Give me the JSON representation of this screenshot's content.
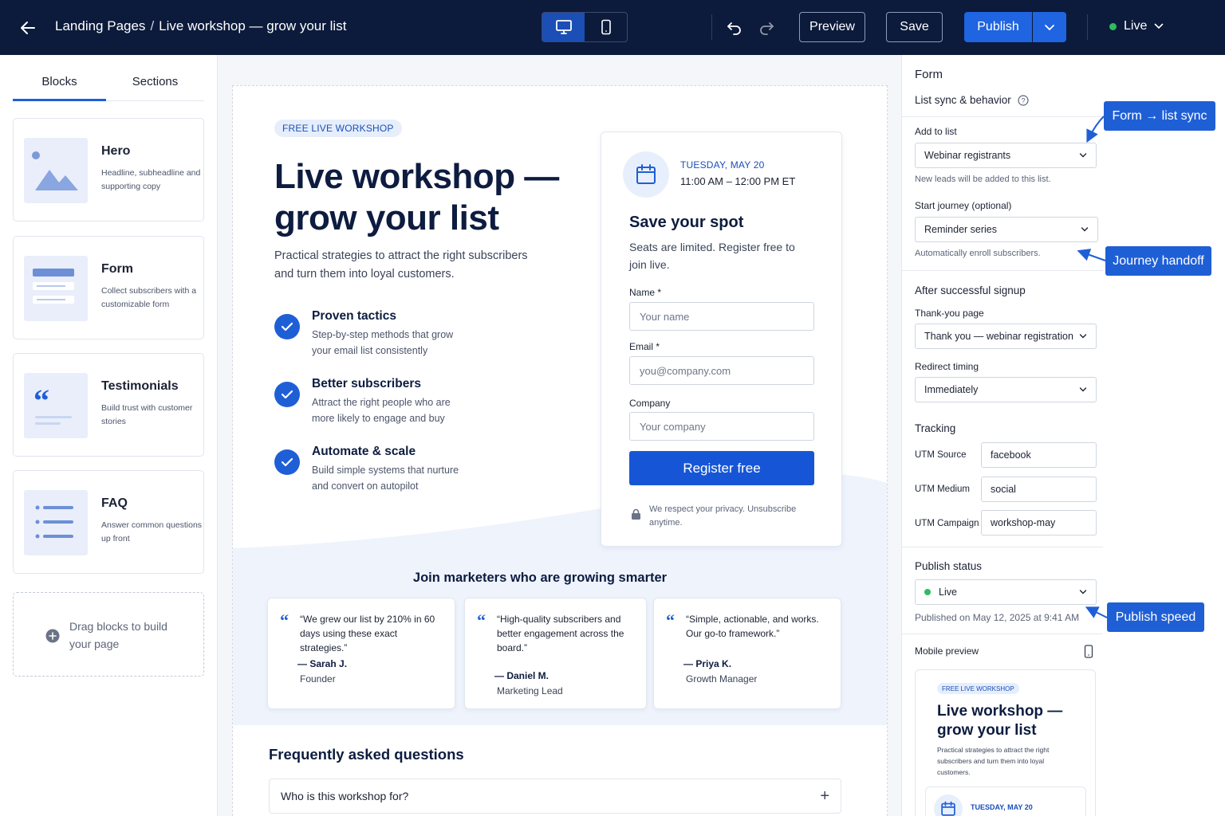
{
  "topbar": {
    "breadcrumb_root": "Landing Pages",
    "breadcrumb_sep": "/",
    "breadcrumb_page": "Live workshop — grow your list",
    "preview_label": "Preview",
    "save_label": "Save",
    "publish_label": "Publish",
    "status_label": "Live"
  },
  "left": {
    "tabs": [
      "Blocks",
      "Sections"
    ],
    "blocks": [
      {
        "title": "Hero",
        "desc": "Headline, subheadline and supporting copy"
      },
      {
        "title": "Form",
        "desc": "Collect subscribers with a customizable form"
      },
      {
        "title": "Testimonials",
        "desc": "Build trust with customer stories"
      },
      {
        "title": "FAQ",
        "desc": "Answer common questions up front"
      }
    ],
    "drop_text": "Drag blocks to build your page"
  },
  "canvas": {
    "badge": "FREE LIVE WORKSHOP",
    "title": "Live workshop — grow your list",
    "subtitle": "Practical strategies to attract the right subscribers and turn them into loyal customers.",
    "features": [
      {
        "title": "Proven tactics",
        "desc": "Step-by-step methods that grow your email list consistently"
      },
      {
        "title": "Better subscribers",
        "desc": "Attract the right people who are more likely to engage and buy"
      },
      {
        "title": "Automate & scale",
        "desc": "Build simple systems that nurture and convert on autopilot"
      }
    ],
    "form": {
      "date": "TUESDAY, MAY 20",
      "time": "11:00 AM – 12:00 PM ET",
      "title": "Save your spot",
      "subtitle": "Seats are limited. Register free to join live.",
      "name_label": "Name *",
      "name_placeholder": "Your name",
      "email_label": "Email *",
      "email_placeholder": "you@company.com",
      "company_label": "Company",
      "company_placeholder": "Your company",
      "submit_label": "Register free",
      "privacy": "We respect your privacy. Unsubscribe anytime."
    },
    "social_heading": "Join marketers who are growing smarter",
    "testimonials": [
      {
        "quote": "“We grew our list by 210% in 60 days using these exact strategies.”",
        "name": "— Sarah J.",
        "role": "Founder"
      },
      {
        "quote": "“High-quality subscribers and better engagement across the board.”",
        "name": "— Daniel M.",
        "role": "Marketing Lead"
      },
      {
        "quote": "“Simple, actionable, and works. Our go-to framework.”",
        "name": "— Priya K.",
        "role": "Growth Manager"
      }
    ],
    "faq_title": "Frequently asked questions",
    "faq_items": [
      {
        "question": "Who is this workshop for?"
      }
    ]
  },
  "right": {
    "title": "Form",
    "subtitle": "List sync & behavior",
    "add_to_list_label": "Add to list",
    "add_to_list_value": "Webinar registrants",
    "add_to_list_help": "New leads will be added to this list.",
    "journey_label": "Start journey",
    "journey_optional": "(optional)",
    "journey_value": "Reminder series",
    "journey_help": "Automatically enroll subscribers.",
    "after_signup_heading": "After successful signup",
    "thankyou_label": "Thank-you page",
    "thankyou_value": "Thank you — webinar registration",
    "redirect_label": "Redirect timing",
    "redirect_value": "Immediately",
    "tracking_heading": "Tracking",
    "utm": [
      {
        "label": "UTM Source",
        "value": "facebook"
      },
      {
        "label": "UTM Medium",
        "value": "social"
      },
      {
        "label": "UTM Campaign",
        "value": "workshop-may"
      }
    ],
    "publish_status_heading": "Publish status",
    "publish_status_value": "Live",
    "published_on": "Published on May 12, 2025 at 9:41 AM",
    "mobile_preview_label": "Mobile preview",
    "mobile": {
      "badge": "FREE LIVE WORKSHOP",
      "title": "Live workshop — grow your list",
      "subtitle": "Practical strategies to attract the right subscribers and turn them into loyal customers.",
      "date": "TUESDAY, MAY 20"
    }
  },
  "callouts": {
    "list_sync": "Form → list sync",
    "journey": "Journey handoff",
    "publish": "Publish speed"
  },
  "colors": {
    "topbar": "#0c1a3b",
    "accent": "#1f5fd6",
    "live": "#2dbd5f"
  }
}
